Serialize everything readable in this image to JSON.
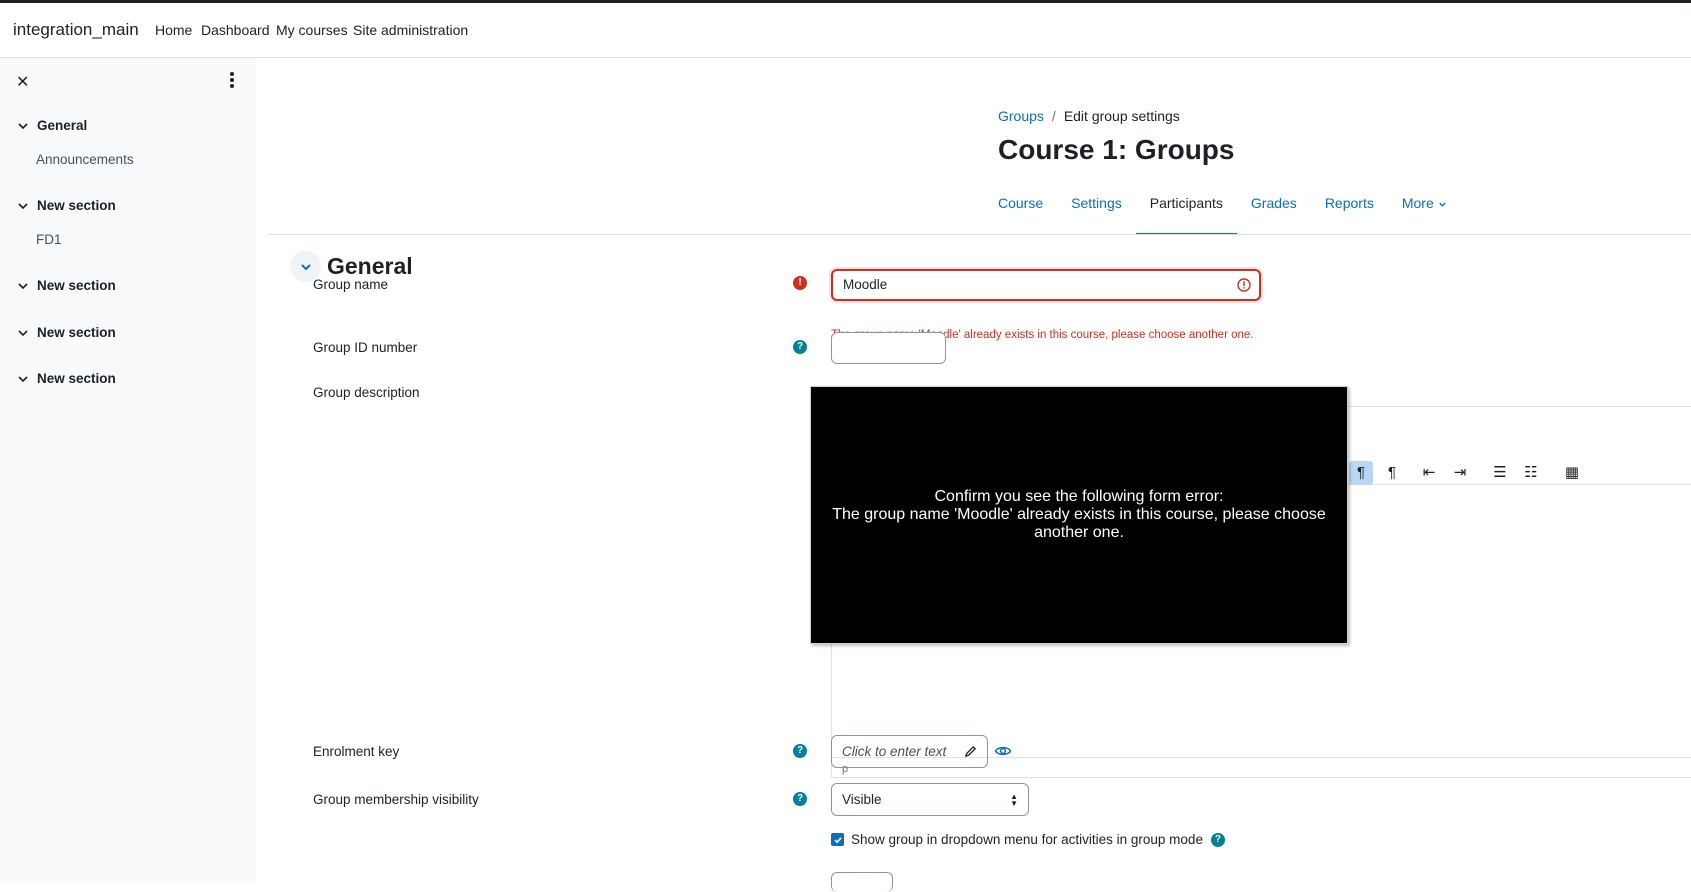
{
  "header": {
    "site_name": "integration_main",
    "nav": [
      "Home",
      "Dashboard",
      "My courses",
      "Site administration"
    ]
  },
  "drawer": {
    "close_glyph": "✕",
    "sections": [
      {
        "label": "General",
        "items": [
          "Announcements"
        ]
      },
      {
        "label": "New section",
        "items": [
          "FD1"
        ]
      },
      {
        "label": "New section",
        "items": []
      },
      {
        "label": "New section",
        "items": []
      },
      {
        "label": "New section",
        "items": []
      }
    ]
  },
  "breadcrumb": {
    "parent": "Groups",
    "separator": "/",
    "current": "Edit group settings"
  },
  "page_title": "Course 1: Groups",
  "tabs": [
    "Course",
    "Settings",
    "Participants",
    "Grades",
    "Reports",
    "More"
  ],
  "active_tab": "Participants",
  "form": {
    "section_title": "General",
    "group_name": {
      "label": "Group name",
      "value": "Moodle",
      "error": "The group name 'Moodle' already exists in this course, please choose another one."
    },
    "group_id_number": {
      "label": "Group ID number",
      "value": ""
    },
    "group_description": {
      "label": "Group description",
      "status_path": "p"
    },
    "enrolment_key": {
      "label": "Enrolment key",
      "placeholder": "Click to enter text"
    },
    "membership_visibility": {
      "label": "Group membership visibility",
      "selected": "Visible"
    },
    "show_in_dropdown": {
      "label": "Show group in dropdown menu for activities in group mode",
      "checked": true
    }
  },
  "overlay": {
    "text": "Confirm you see the following form error:\nThe group name 'Moodle' already exists in this course, please choose another one."
  },
  "toolbar_icons": [
    "list-icon",
    "ltr-icon",
    "rtl-icon",
    "outdent-icon",
    "indent-icon",
    "bullet-list-icon",
    "numbered-list-icon",
    "table-icon"
  ],
  "colors": {
    "link": "#0f6cbf",
    "error": "#ca3120",
    "help": "#008196",
    "active_tool": "#b8d7f5"
  }
}
